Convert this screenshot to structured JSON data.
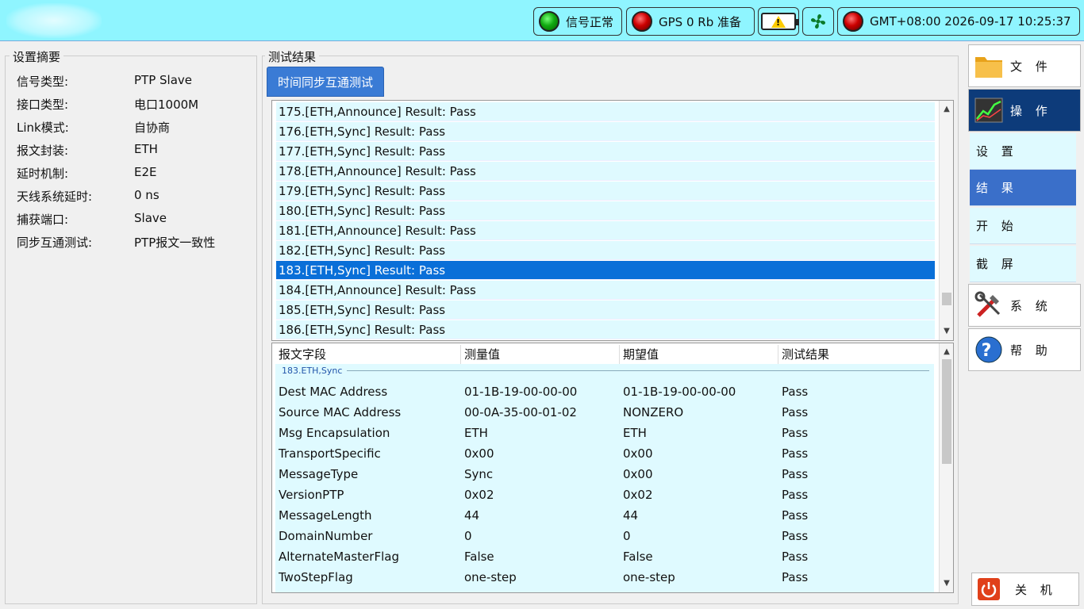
{
  "status_bar": {
    "signal_label": "信号正常",
    "gps_label": "GPS 0  Rb 准备",
    "warning_icon": "warning-icon",
    "fan_icon": "fan-icon",
    "datetime": "GMT+08:00 2026-09-17 10:25:37",
    "colors": {
      "ok": "#1a1",
      "alarm": "#c00",
      "bar_bg": "#8ff5ff"
    }
  },
  "summary": {
    "title": "设置摘要",
    "rows": [
      {
        "key": "信号类型:",
        "value": "PTP Slave"
      },
      {
        "key": "接口类型:",
        "value": "电口1000M"
      },
      {
        "key": "Link模式:",
        "value": "自协商"
      },
      {
        "key": "报文封装:",
        "value": "ETH"
      },
      {
        "key": "延时机制:",
        "value": "E2E"
      },
      {
        "key": "天线系统延时:",
        "value": "0 ns"
      },
      {
        "key": "捕获端口:",
        "value": "Slave"
      },
      {
        "key": "同步互通测试:",
        "value": "PTP报文一致性"
      }
    ]
  },
  "results": {
    "title": "测试结果",
    "tab": "时间同步互通测试",
    "list": [
      "175.[ETH,Announce] Result: Pass",
      "176.[ETH,Sync] Result: Pass",
      "177.[ETH,Sync] Result: Pass",
      "178.[ETH,Announce] Result: Pass",
      "179.[ETH,Sync] Result: Pass",
      "180.[ETH,Sync] Result: Pass",
      "181.[ETH,Announce] Result: Pass",
      "182.[ETH,Sync] Result: Pass",
      "183.[ETH,Sync] Result: Pass",
      "184.[ETH,Announce] Result: Pass",
      "185.[ETH,Sync] Result: Pass",
      "186.[ETH,Sync] Result: Pass"
    ],
    "selected_index": 8,
    "detail": {
      "headers": [
        "报文字段",
        "测量值",
        "期望值",
        "测试结果"
      ],
      "group": "183.ETH,Sync",
      "rows": [
        [
          "Dest MAC Address",
          "01-1B-19-00-00-00",
          "01-1B-19-00-00-00",
          "Pass"
        ],
        [
          "Source MAC Address",
          "00-0A-35-00-01-02",
          "NONZERO",
          "Pass"
        ],
        [
          "Msg Encapsulation",
          "ETH",
          "ETH",
          "Pass"
        ],
        [
          "TransportSpecific",
          "0x00",
          "0x00",
          "Pass"
        ],
        [
          "MessageType",
          "Sync",
          "0x00",
          "Pass"
        ],
        [
          "VersionPTP",
          "0x02",
          "0x02",
          "Pass"
        ],
        [
          "MessageLength",
          "44",
          "44",
          "Pass"
        ],
        [
          "DomainNumber",
          "0",
          "0",
          "Pass"
        ],
        [
          "AlternateMasterFlag",
          "False",
          "False",
          "Pass"
        ],
        [
          "TwoStepFlag",
          "one-step",
          "one-step",
          "Pass"
        ]
      ]
    }
  },
  "menu": {
    "file": "文 件",
    "operate": "操 作",
    "sub": [
      "设 置",
      "结 果",
      "开 始",
      "截 屏"
    ],
    "active_sub": 1,
    "system": "系 统",
    "help": "帮 助",
    "shutdown": "关 机"
  }
}
